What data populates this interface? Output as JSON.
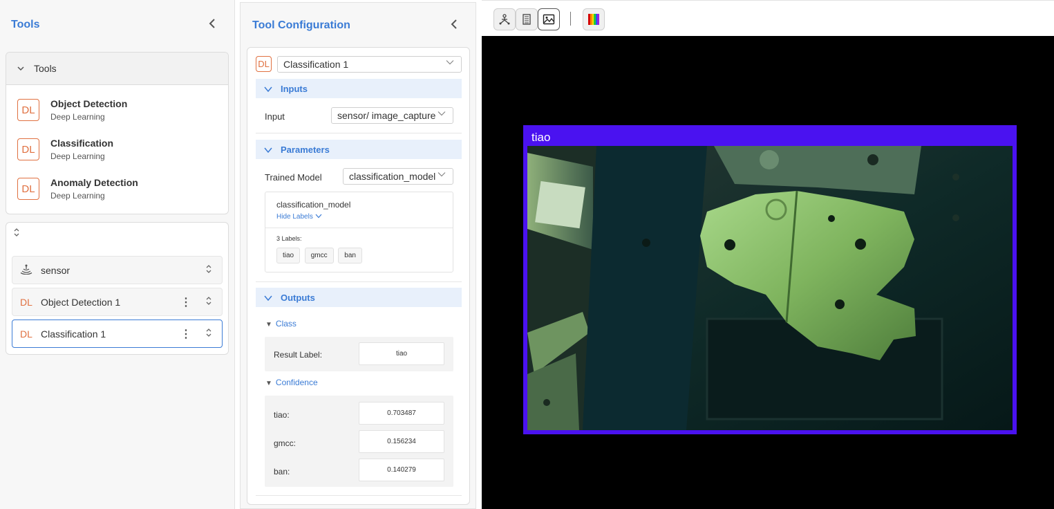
{
  "left_panel": {
    "title": "Tools",
    "tools_section": {
      "header": "Tools",
      "items": [
        {
          "badge": "DL",
          "name": "Object Detection",
          "category": "Deep Learning"
        },
        {
          "badge": "DL",
          "name": "Classification",
          "category": "Deep Learning"
        },
        {
          "badge": "DL",
          "name": "Anomaly Detection",
          "category": "Deep Learning"
        }
      ]
    },
    "pipeline": [
      {
        "name": "sensor",
        "icon": "sensor-icon"
      },
      {
        "badge": "DL",
        "name": "Object Detection 1"
      },
      {
        "badge": "DL",
        "name": "Classification 1",
        "selected": true
      }
    ]
  },
  "config_panel": {
    "title": "Tool Configuration",
    "badge": "DL",
    "selected_tool": "Classification 1",
    "inputs": {
      "header": "Inputs",
      "input_label": "Input",
      "input_value": "sensor/ image_capture"
    },
    "parameters": {
      "header": "Parameters",
      "model_label": "Trained Model",
      "model_value": "classification_model",
      "model_name": "classification_model",
      "hide_labels": "Hide Labels",
      "labels_count": "3 Labels:",
      "labels": [
        "tiao",
        "gmcc",
        "ban"
      ]
    },
    "outputs": {
      "header": "Outputs",
      "class_header": "Class",
      "result_label": "Result Label:",
      "result_value": "tiao",
      "confidence_header": "Confidence",
      "confidence": [
        {
          "label": "tiao:",
          "value": "0.703487"
        },
        {
          "label": "gmcc:",
          "value": "0.156234"
        },
        {
          "label": "ban:",
          "value": "0.140279"
        }
      ]
    }
  },
  "viewer": {
    "tools": [
      "3d-view-icon",
      "document-icon",
      "image-icon",
      "colormap-icon"
    ],
    "active_tool": "image-icon",
    "detection_label": "tiao",
    "detection_color": "#4a12f0"
  },
  "colors": {
    "accent": "#3a7bd5",
    "dl_badge": "#e07040",
    "section_bg": "#e8f0fb"
  }
}
